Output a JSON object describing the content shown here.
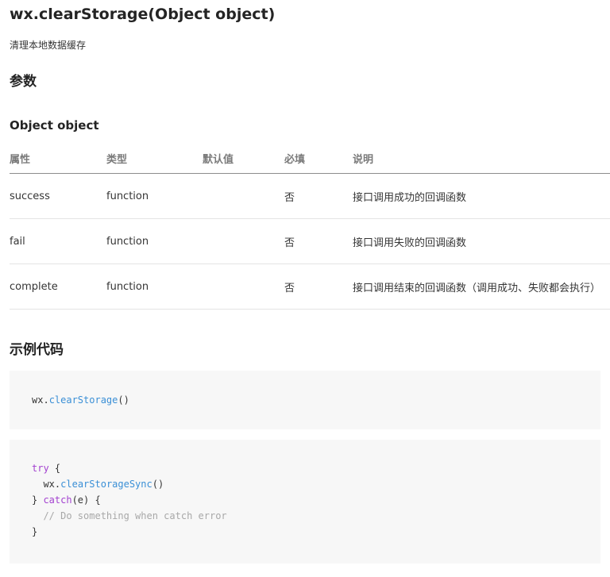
{
  "title": "wx.clearStorage(Object object)",
  "description": "清理本地数据缓存",
  "params_heading": "参数",
  "object_heading": "Object object",
  "table": {
    "headers": [
      "属性",
      "类型",
      "默认值",
      "必填",
      "说明"
    ],
    "rows": [
      {
        "name": "success",
        "type": "function",
        "default": "",
        "required": "否",
        "desc": "接口调用成功的回调函数"
      },
      {
        "name": "fail",
        "type": "function",
        "default": "",
        "required": "否",
        "desc": "接口调用失败的回调函数"
      },
      {
        "name": "complete",
        "type": "function",
        "default": "",
        "required": "否",
        "desc": "接口调用结束的回调函数（调用成功、失败都会执行）"
      }
    ]
  },
  "example_heading": "示例代码",
  "code1": {
    "obj": "wx",
    "dot": ".",
    "method": "clearStorage",
    "parens": "()"
  },
  "code2": {
    "try_kw": "try",
    "open_brace": " {",
    "indent": "  ",
    "obj": "wx",
    "dot": ".",
    "method": "clearStorageSync",
    "parens": "()",
    "close_brace": "} ",
    "catch_kw": "catch",
    "catch_args": "(e) {",
    "comment": "// Do something when catch error",
    "final_brace": "}"
  },
  "colors": {
    "keyword": "#a342d0",
    "function": "#3a8fd6",
    "comment": "#a8a8a8",
    "code_background": "#f7f7f7"
  }
}
